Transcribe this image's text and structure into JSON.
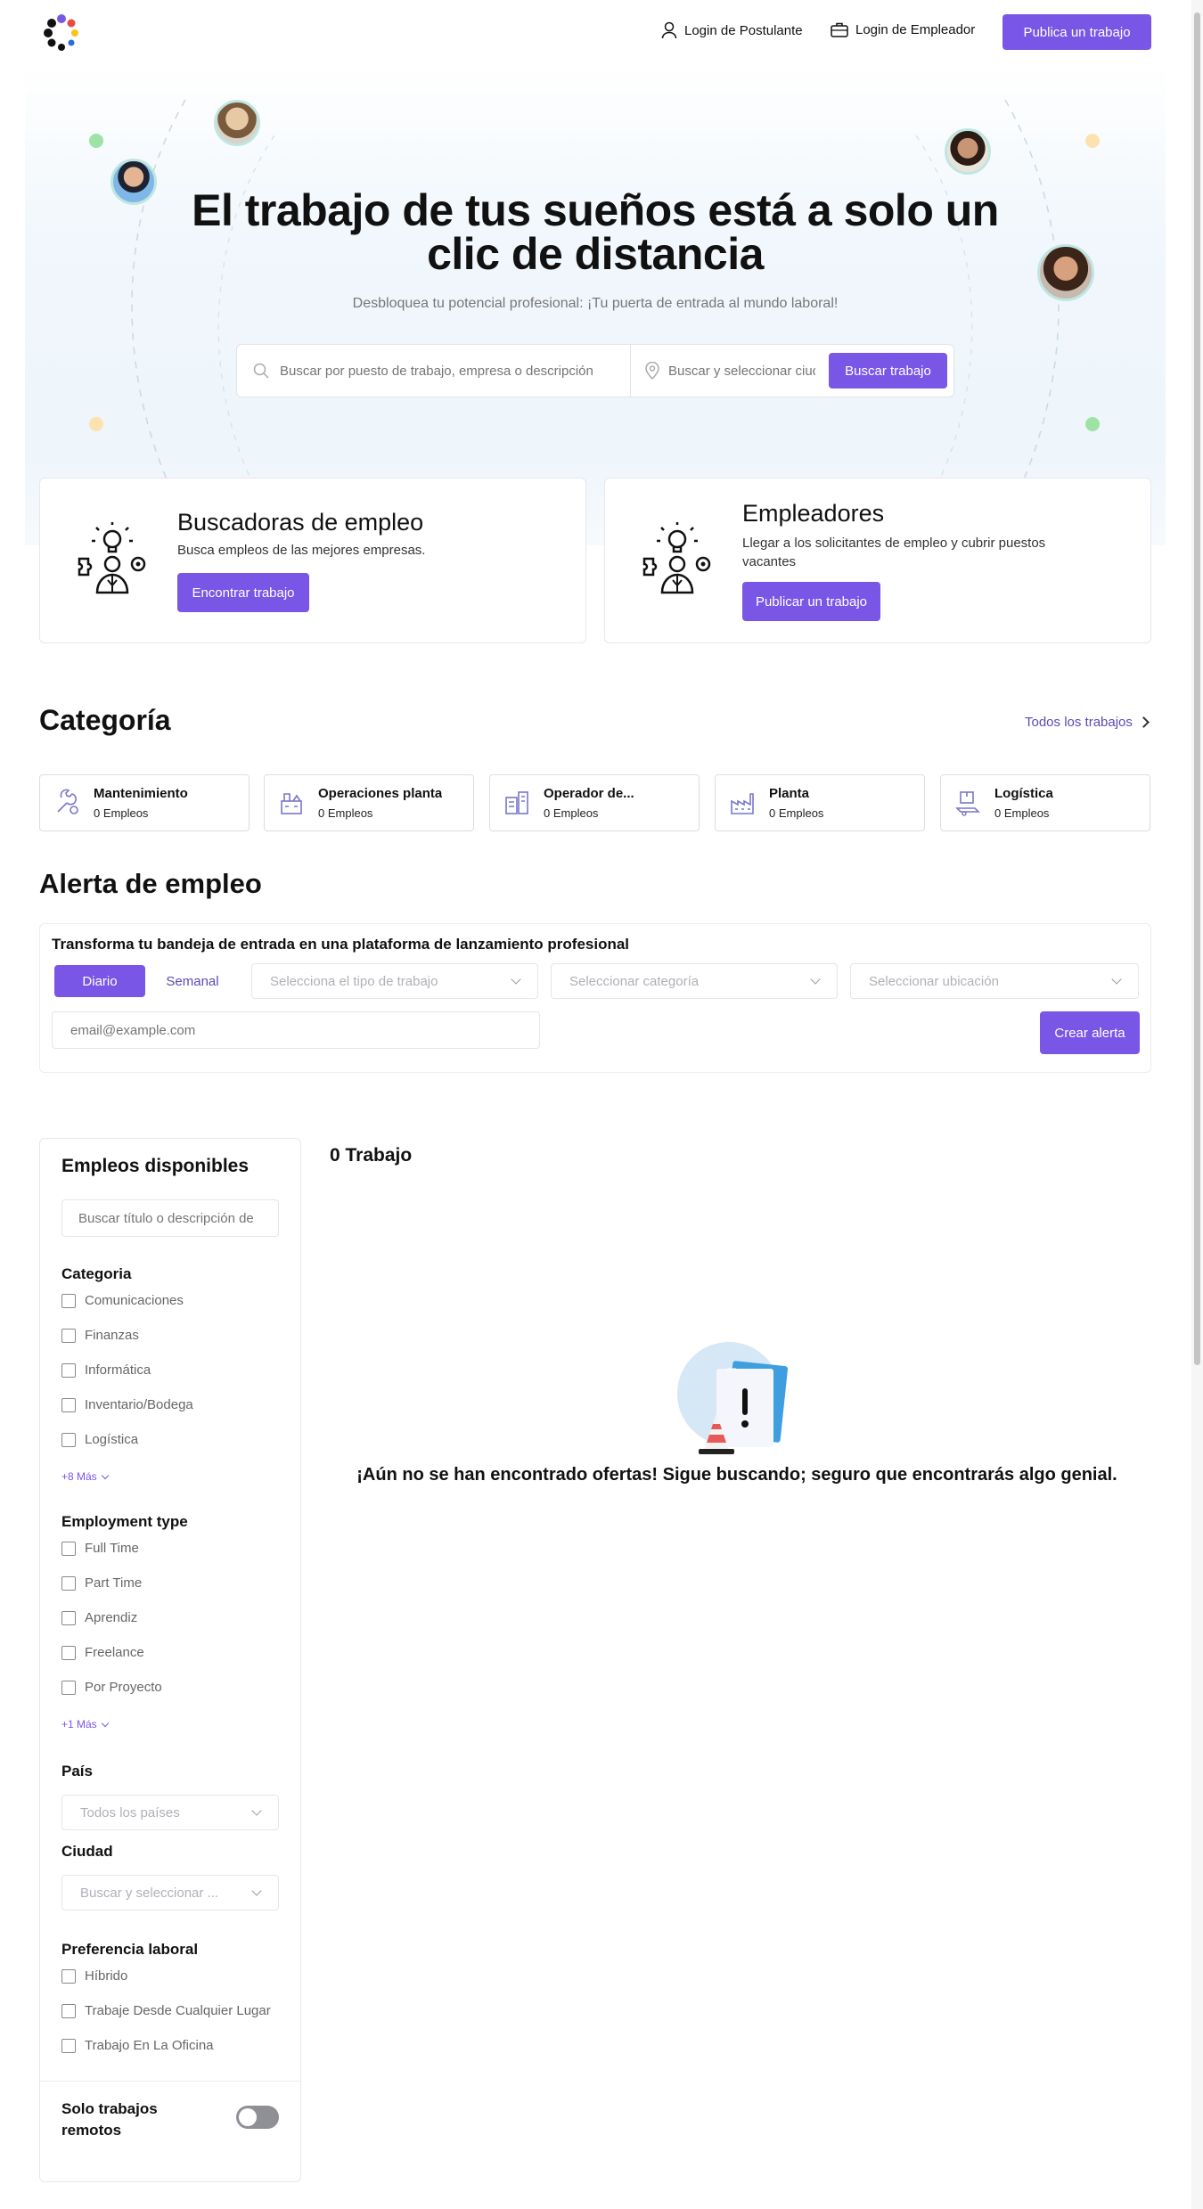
{
  "header": {
    "login_candidate": "Login de Postulante",
    "login_employer": "Login de Empleador",
    "post_job": "Publica un trabajo"
  },
  "hero": {
    "title_line1": "El trabajo de tus sueños está a solo un",
    "title_line2": "clic de distancia",
    "subtitle": "Desbloquea tu potencial profesional: ¡Tu puerta de entrada al mundo laboral!",
    "search_placeholder": "Buscar por puesto de trabajo, empresa o descripción",
    "location_placeholder": "Buscar y seleccionar ciudad",
    "search_button": "Buscar trabajo"
  },
  "promo": {
    "seekers": {
      "title": "Buscadoras de empleo",
      "text": "Busca empleos de las mejores empresas.",
      "button": "Encontrar trabajo"
    },
    "employers": {
      "title": "Empleadores",
      "text": "Llegar a los solicitantes de empleo y cubrir puestos vacantes",
      "button": "Publicar un trabajo"
    }
  },
  "categories": {
    "title": "Categoría",
    "all_link": "Todos los trabajos",
    "items": [
      {
        "name": "Mantenimiento",
        "count": "0 Empleos"
      },
      {
        "name": "Operaciones planta",
        "count": "0 Empleos"
      },
      {
        "name": "Operador de...",
        "count": "0 Empleos"
      },
      {
        "name": "Planta",
        "count": "0 Empleos"
      },
      {
        "name": "Logística",
        "count": "0 Empleos"
      }
    ]
  },
  "alert": {
    "title": "Alerta de empleo",
    "subtitle": "Transforma tu bandeja de entrada en una plataforma de lanzamiento profesional",
    "tab_daily": "Diario",
    "tab_weekly": "Semanal",
    "job_type_placeholder": "Selecciona el tipo de trabajo",
    "category_placeholder": "Seleccionar categoría",
    "location_placeholder": "Seleccionar ubicación",
    "email_placeholder": "email@example.com",
    "create_button": "Crear alerta"
  },
  "sidebar": {
    "title": "Empleos disponibles",
    "search_placeholder": "Buscar título o descripción de",
    "category_heading": "Categoria",
    "categories": [
      "Comunicaciones",
      "Finanzas",
      "Informática",
      "Inventario/Bodega",
      "Logística"
    ],
    "categories_more": "+8 Más",
    "employment_heading": "Employment type",
    "employment_types": [
      "Full Time",
      "Part Time",
      "Aprendiz",
      "Freelance",
      "Por Proyecto"
    ],
    "employment_more": "+1 Más",
    "country_heading": "País",
    "country_placeholder": "Todos los países",
    "city_heading": "Ciudad",
    "city_placeholder": "Buscar y seleccionar ...",
    "preference_heading": "Preferencia laboral",
    "preferences": [
      "Híbrido",
      "Trabaje Desde Cualquier Lugar",
      "Trabajo En La Oficina"
    ],
    "remote_label": "Solo trabajos remotos",
    "remote_on": false
  },
  "results": {
    "count_label": "0 Trabajo",
    "empty_message": "¡Aún no se han encontrado ofertas! Sigue buscando; seguro que encontrarás algo genial."
  },
  "colors": {
    "accent": "#7a56e6",
    "hero_bg": "#f3f8fc",
    "avatar_ring": "#bfe6e2",
    "dot_green": "#9ee2a6",
    "dot_yellow": "#fde2b0"
  }
}
